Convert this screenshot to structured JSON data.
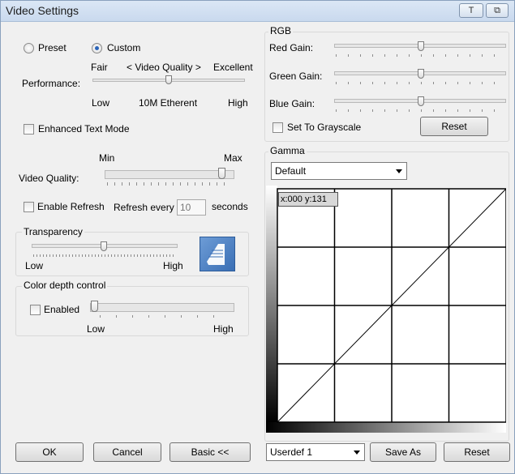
{
  "window": {
    "title": "Video Settings",
    "pin_label": "T",
    "restore_label": "⧉"
  },
  "mode": {
    "preset_label": "Preset",
    "custom_label": "Custom",
    "selected": "Custom"
  },
  "performance": {
    "label": "Performance:",
    "top_left": "Fair",
    "top_center": "< Video Quality >",
    "top_right": "Excellent",
    "bottom_left": "Low",
    "bottom_center": "10M Etherent",
    "bottom_right": "High",
    "level": 0.5
  },
  "enhanced_text": {
    "label": "Enhanced Text Mode",
    "checked": false
  },
  "video_quality": {
    "label": "Video Quality:",
    "min_label": "Min",
    "max_label": "Max",
    "level": 0.9
  },
  "refresh": {
    "label": "Enable Refresh",
    "checked": false,
    "every_label": "Refresh every",
    "value": "10",
    "unit": "seconds"
  },
  "transparency": {
    "legend": "Transparency",
    "low": "Low",
    "high": "High",
    "level": 0.5
  },
  "color_depth": {
    "legend": "Color depth control",
    "enabled_label": "Enabled",
    "checked": false,
    "low": "Low",
    "high": "High",
    "level": 0.0
  },
  "rgb": {
    "legend": "RGB",
    "red_label": "Red Gain:",
    "red_level": 0.5,
    "green_label": "Green Gain:",
    "green_level": 0.5,
    "blue_label": "Blue Gain:",
    "blue_level": 0.5,
    "grayscale_label": "Set To Grayscale",
    "grayscale_checked": false,
    "reset_label": "Reset"
  },
  "gamma": {
    "legend": "Gamma",
    "preset_value": "Default",
    "coord_readout": "x:000 y:131",
    "curve_select": "Userdef 1",
    "save_as_label": "Save As",
    "reset_label": "Reset"
  },
  "footer": {
    "ok_label": "OK",
    "cancel_label": "Cancel",
    "basic_label": "Basic <<"
  },
  "icons": {
    "transparency_icon": "window-transparency-icon"
  }
}
